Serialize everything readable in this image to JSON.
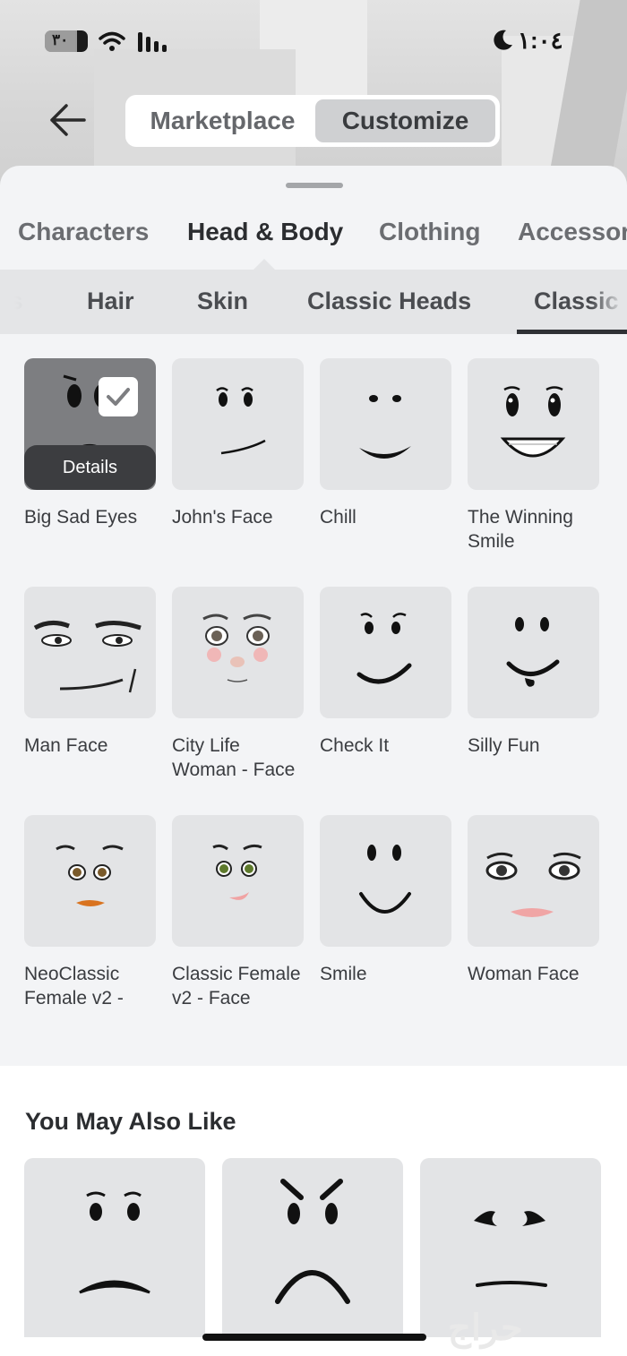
{
  "status_bar": {
    "time": "١:٠٤",
    "battery": "٣٠"
  },
  "header": {
    "back_icon": "arrow-left-icon",
    "tabs": [
      {
        "label": "Marketplace",
        "active": false
      },
      {
        "label": "Customize",
        "active": true
      }
    ]
  },
  "category_tabs": [
    {
      "label": "Characters",
      "active": false
    },
    {
      "label": "Head & Body",
      "active": true
    },
    {
      "label": "Clothing",
      "active": false
    },
    {
      "label": "Accessor",
      "active": false
    }
  ],
  "subcategory_tabs": [
    {
      "label": "ds",
      "active": false
    },
    {
      "label": "Hair",
      "active": false
    },
    {
      "label": "Skin",
      "active": false
    },
    {
      "label": "Classic Heads",
      "active": false
    },
    {
      "label": "Classic",
      "active": true
    }
  ],
  "items": [
    {
      "name": "Big Sad Eyes",
      "selected": true,
      "details_label": "Details"
    },
    {
      "name": "John's Face",
      "selected": false
    },
    {
      "name": "Chill",
      "selected": false
    },
    {
      "name": "The Winning Smile",
      "selected": false
    },
    {
      "name": "Man Face",
      "selected": false
    },
    {
      "name": "City Life Woman - Face",
      "selected": false
    },
    {
      "name": "Check It",
      "selected": false
    },
    {
      "name": "Silly Fun",
      "selected": false
    },
    {
      "name": "NeoClassic Female v2 -",
      "selected": false
    },
    {
      "name": "Classic Female v2 - Face",
      "selected": false
    },
    {
      "name": "Smile",
      "selected": false
    },
    {
      "name": "Woman Face",
      "selected": false
    }
  ],
  "recommendations": {
    "title": "You May Also Like",
    "items": [
      "sad-face",
      "angry-face",
      "worried-face"
    ]
  },
  "watermark": "حراج",
  "colors": {
    "selected_tab_bg": "#cfd0d2",
    "details_bg": "#3c3d40",
    "tile_bg": "#e3e4e6"
  }
}
